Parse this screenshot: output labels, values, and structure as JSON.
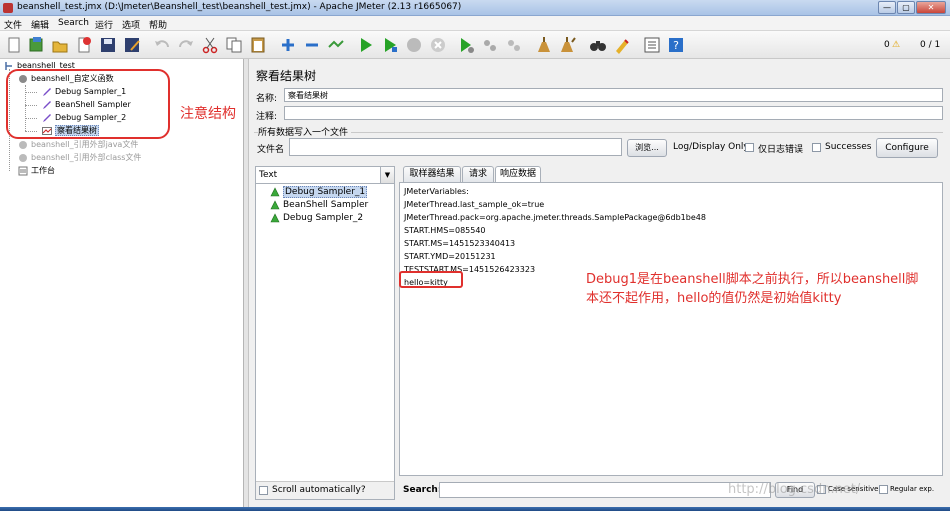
{
  "window": {
    "title": "beanshell_test.jmx (D:\\Jmeter\\Beanshell_test\\beanshell_test.jmx) - Apache JMeter (2.13 r1665067)",
    "minimize": "—",
    "maximize": "▢",
    "close": "✕"
  },
  "menu": [
    "文件",
    "编辑",
    "Search",
    "运行",
    "选项",
    "帮助"
  ],
  "toolbar_status": {
    "warnings": "0",
    "threads": "0 / 1"
  },
  "tree": {
    "root": "beanshell_test",
    "group": "beanshell_自定义函数",
    "children": [
      "Debug Sampler_1",
      "BeanShell Sampler",
      "Debug Sampler_2",
      "察看结果树"
    ],
    "dim_items": [
      "beanshell_引用外部java文件",
      "beanshell_引用外部class文件"
    ],
    "workbench": "工作台",
    "annotation": "注意结构"
  },
  "panel": {
    "title": "察看结果树",
    "name_label": "名称:",
    "name_value": "察看结果树",
    "comment_label": "注释:",
    "comment_value": "",
    "group_title": "所有数据写入一个文件",
    "file_label": "文件名",
    "file_value": "",
    "browse": "浏览...",
    "log_display": "Log/Display Only:",
    "errors_only": "仅日志错误",
    "successes": "Successes",
    "configure": "Configure"
  },
  "results": {
    "renderer": "Text",
    "items": [
      "Debug Sampler_1",
      "BeanShell Sampler",
      "Debug Sampler_2"
    ],
    "scroll_auto": "Scroll automatically?"
  },
  "tabs": [
    "取样器结果",
    "请求",
    "响应数据"
  ],
  "response_lines": [
    "JMeterVariables:",
    "JMeterThread.last_sample_ok=true",
    "JMeterThread.pack=org.apache.jmeter.threads.SamplePackage@6db1be48",
    "START.HMS=085540",
    "START.MS=1451523340413",
    "START.YMD=20151231",
    "TESTSTART.MS=1451526423323",
    "hello=kitty"
  ],
  "response_note": "Debug1是在beanshell脚本之前执行，所以beanshell脚本还不起作用，hello的值仍然是初始值kitty",
  "search": {
    "label": "Search:",
    "value": "",
    "find": "Find",
    "case_sensitive": "Case sensitive",
    "regular_exp": "Regular exp."
  },
  "watermark": "http://blog.csdn.net/"
}
